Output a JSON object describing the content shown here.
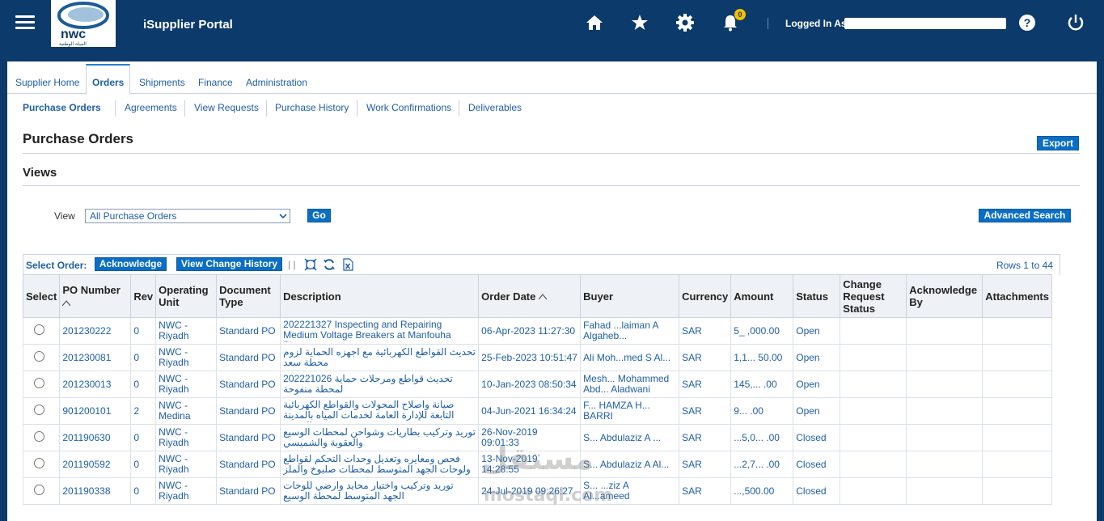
{
  "header": {
    "app_title": "iSupplier Portal",
    "logged_in_label": "Logged In As",
    "notification_count": "0",
    "logo_text": "nwc",
    "logo_subtext": "المياه الوطنية",
    "icons": [
      "menu-icon",
      "home-icon",
      "favorites-star-icon",
      "settings-gear-icon",
      "notifications-bell-icon",
      "help-icon",
      "logout-power-icon"
    ]
  },
  "tabs": [
    "Supplier Home",
    "Orders",
    "Shipments",
    "Finance",
    "Administration"
  ],
  "subnav": [
    "Purchase Orders",
    "Agreements",
    "View Requests",
    "Purchase History",
    "Work Confirmations",
    "Deliverables"
  ],
  "page": {
    "title": "Purchase Orders",
    "export_label": "Export",
    "views_title": "Views",
    "view_label": "View",
    "view_value": "All Purchase Orders",
    "go_label": "Go",
    "advanced_search_label": "Advanced Search"
  },
  "toolbar": {
    "select_order_label": "Select Order:",
    "acknowledge_label": "Acknowledge",
    "view_change_history_label": "View Change History",
    "rows_info": "Rows 1 to 44",
    "icons": [
      "expand-icon",
      "refresh-icon",
      "excel-export-icon"
    ]
  },
  "table": {
    "columns": [
      "Select",
      "PO Number",
      "Rev",
      "Operating Unit",
      "Document Type",
      "Description",
      "Order Date",
      "Buyer",
      "Currency",
      "Amount",
      "Status",
      "Change Request Status",
      "Acknowledge By",
      "Attachments"
    ],
    "rows": [
      {
        "po": "201230222",
        "rev": "0",
        "ou": "NWC - Riyadh",
        "doc": "Standard PO",
        "desc": "202221327 Inspecting and Repairing Medium Voltage Breakers at Manfouha Plant",
        "date": "06-Apr-2023 11:27:30",
        "buyer": "Fahad ...laiman A Algaheb...",
        "currency": "SAR",
        "amount": "5_ ,000.00",
        "status": "Open"
      },
      {
        "po": "201230081",
        "rev": "0",
        "ou": "NWC - Riyadh",
        "doc": "Standard PO",
        "desc": "تحديث القواطع الكهربائية مع اجهزه الحماية لزوم محطة سعد",
        "date": "25-Feb-2023 10:51:47",
        "buyer": "Ali Moh...med S Al...",
        "currency": "SAR",
        "amount": "1,1... 50.00",
        "status": "Open"
      },
      {
        "po": "201230013",
        "rev": "0",
        "ou": "NWC - Riyadh",
        "doc": "Standard PO",
        "desc": "202221026 تحديث قواطع ومرحلات حماية لمحطة منفوحة",
        "date": "10-Jan-2023 08:50:34",
        "buyer": "Mesh... Mohammed Abd... Aladwani",
        "currency": "SAR",
        "amount": "145,... .00",
        "status": "Open"
      },
      {
        "po": "901200101",
        "rev": "2",
        "ou": "NWC - Medina",
        "doc": "Standard PO",
        "desc": "صيانة وأصلاح المحولات والقواطع الكهربائية التابعة للإدارة العامة لخدمات المياه بالمدينة المنورة",
        "date": "04-Jun-2021 16:34:24",
        "buyer": "F... HAMZA H... BARRI",
        "currency": "SAR",
        "amount": "9... .00",
        "status": "Open"
      },
      {
        "po": "201190630",
        "rev": "0",
        "ou": "NWC - Riyadh",
        "doc": "Standard PO",
        "desc": "توريد وتركيب بطاريات وشواحن لمحطات الوسيع والعقوبة والشميسي",
        "date": "26-Nov-2019 09:01:33",
        "buyer": "S... Abdulaziz A ...",
        "currency": "SAR",
        "amount": "...5,0... .00",
        "status": "Closed"
      },
      {
        "po": "201190592",
        "rev": "0",
        "ou": "NWC - Riyadh",
        "doc": "Standard PO",
        "desc": "فحص ومعايره وتعديل وحدات التحكم لقواطع ولوحات الجهد المتوسط لمحطات صلبوخ والملز",
        "date": "13-Nov-2019 14:28:55",
        "buyer": "S... Abdulaziz A Al...",
        "currency": "SAR",
        "amount": "...2,7... .00",
        "status": "Closed"
      },
      {
        "po": "201190338",
        "rev": "0",
        "ou": "NWC - Riyadh",
        "doc": "Standard PO",
        "desc": "توريد وتركيب واختبار محايد وارضي للوحات الجهد المتوسط لمحطة الوسيع",
        "date": "24-Jul-2019 09:26:27",
        "buyer": "S... ...ziz A Al...ameed",
        "currency": "SAR",
        "amount": "...,500.00",
        "status": "Closed"
      }
    ]
  },
  "watermark": {
    "line1": "مستقل",
    "line2": "mostaql.com"
  }
}
